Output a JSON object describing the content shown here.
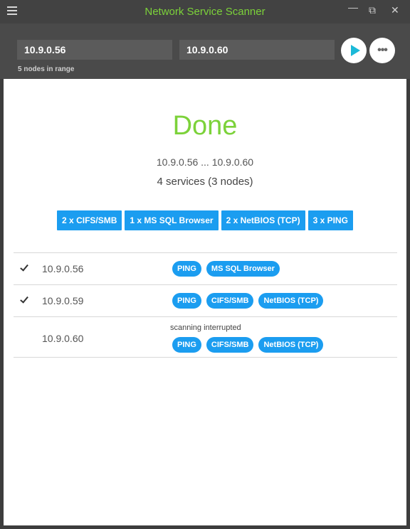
{
  "window": {
    "title": "Network Service Scanner",
    "maximize_glyph": "⧉",
    "close_glyph": "✕",
    "minimize_glyph": "—"
  },
  "toolbar": {
    "start_ip": "10.9.0.56",
    "end_ip": "10.9.0.60",
    "range_info": "5 nodes in range",
    "more_glyph": "•••"
  },
  "main": {
    "status": "Done",
    "range": "10.9.0.56 ... 10.9.0.60",
    "summary": "4 services (3 nodes)",
    "summary_tags": [
      "2 x CIFS/SMB",
      "1 x MS SQL Browser",
      "2 x NetBIOS (TCP)",
      "3 x PING"
    ]
  },
  "results": [
    {
      "ip": "10.9.0.56",
      "checked": true,
      "note": "",
      "services": [
        "PING",
        "MS SQL Browser"
      ]
    },
    {
      "ip": "10.9.0.59",
      "checked": true,
      "note": "",
      "services": [
        "PING",
        "CIFS/SMB",
        "NetBIOS (TCP)"
      ]
    },
    {
      "ip": "10.9.0.60",
      "checked": false,
      "note": "scanning interrupted",
      "services": [
        "PING",
        "CIFS/SMB",
        "NetBIOS (TCP)"
      ]
    }
  ],
  "colors": {
    "accent_green": "#7cd23a",
    "tag_blue": "#1b9df0",
    "play_cyan": "#1bb9d8"
  },
  "icons": [
    "hamburger-menu-icon",
    "maximize-icon",
    "close-icon",
    "minimize-icon",
    "play-icon",
    "more-icon",
    "check-icon"
  ]
}
